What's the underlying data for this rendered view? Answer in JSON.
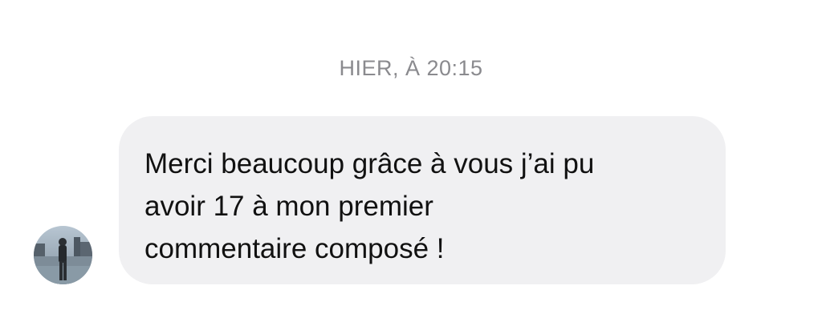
{
  "conversation": {
    "timestamp": "HIER, À 20:15",
    "message": {
      "lines": [
        "Merci beaucoup grâce à vous j’ai pu",
        "avoir 17 à mon premier",
        "commentaire composé !"
      ]
    },
    "sender": {
      "avatar_icon": "avatar-photo"
    }
  },
  "colors": {
    "background": "#ffffff",
    "bubble": "#f0f0f2",
    "timestamp_text": "#8a8a8e",
    "message_text": "#111111"
  }
}
